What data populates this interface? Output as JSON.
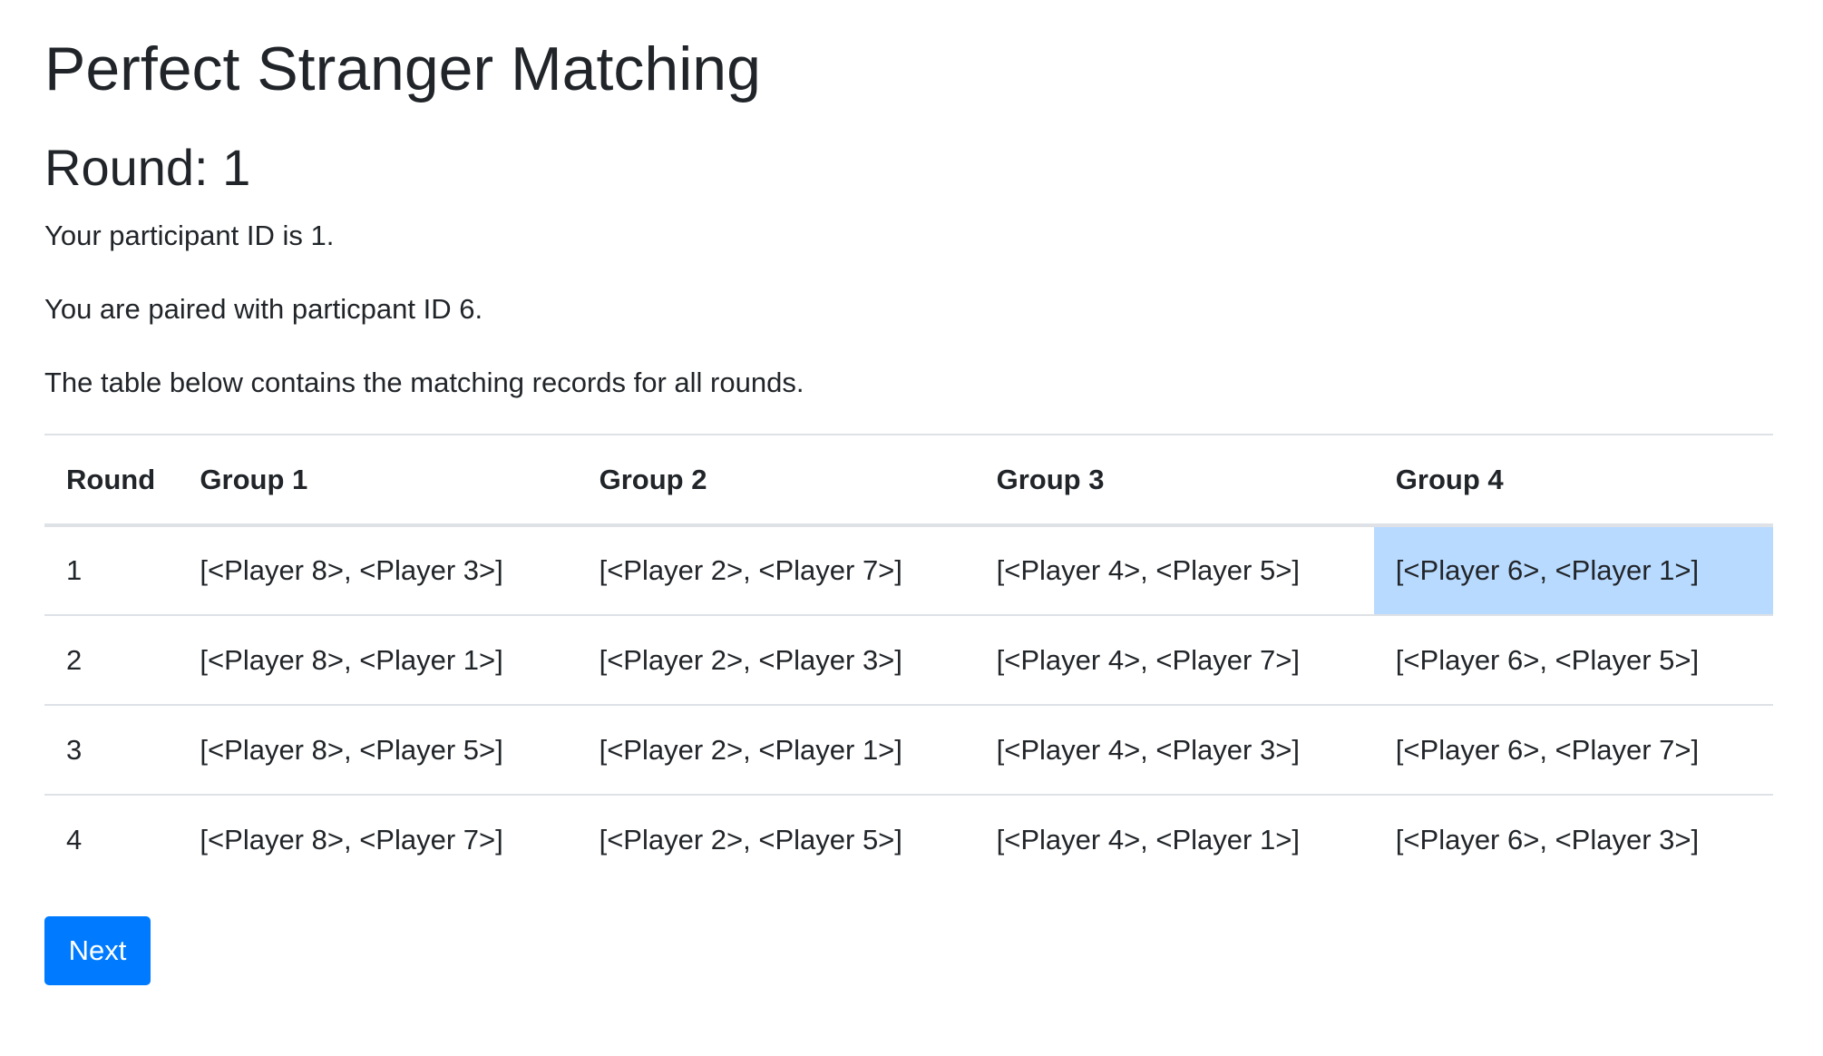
{
  "page": {
    "title": "Perfect Stranger Matching",
    "round_heading": "Round: 1",
    "participant_text": "Your participant ID is 1.",
    "paired_text": "You are paired with particpant ID 6.",
    "table_intro": "The table below contains the matching records for all rounds."
  },
  "table": {
    "headers": [
      "Round",
      "Group 1",
      "Group 2",
      "Group 3",
      "Group 4"
    ],
    "rows": [
      [
        "1",
        "[<Player 8>, <Player 3>]",
        "[<Player 2>, <Player 7>]",
        "[<Player 4>, <Player 5>]",
        "[<Player 6>, <Player 1>]"
      ],
      [
        "2",
        "[<Player 8>, <Player 1>]",
        "[<Player 2>, <Player 3>]",
        "[<Player 4>, <Player 7>]",
        "[<Player 6>, <Player 5>]"
      ],
      [
        "3",
        "[<Player 8>, <Player 5>]",
        "[<Player 2>, <Player 1>]",
        "[<Player 4>, <Player 3>]",
        "[<Player 6>, <Player 7>]"
      ],
      [
        "4",
        "[<Player 8>, <Player 7>]",
        "[<Player 2>, <Player 5>]",
        "[<Player 4>, <Player 1>]",
        "[<Player 6>, <Player 3>]"
      ]
    ],
    "highlight_color": "#b8daff",
    "border_color": "#dee2e6"
  },
  "actions": {
    "next_label": "Next",
    "button_color": "#007bff"
  }
}
